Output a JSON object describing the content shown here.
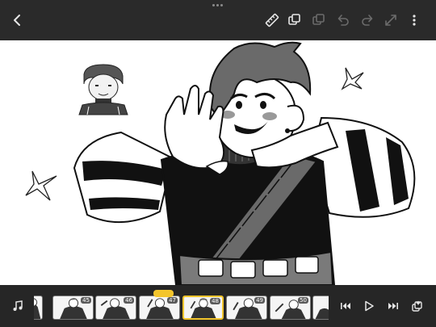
{
  "toolbar": {
    "icons": [
      "back-chevron-icon",
      "ruler-icon",
      "layers-icon",
      "copy-icon",
      "undo-icon",
      "redo-icon",
      "expand-icon",
      "more-icon"
    ]
  },
  "timeline": {
    "frames": [
      {
        "label": ""
      },
      {
        "label": "45"
      },
      {
        "label": "46"
      },
      {
        "label": "47"
      },
      {
        "label": "48"
      },
      {
        "label": "49"
      },
      {
        "label": "50"
      },
      {
        "label": ""
      }
    ],
    "current_frame": "48",
    "accent_color": "#f3c52c"
  },
  "playback": {
    "icons": [
      "music-icon",
      "skip-back-icon",
      "play-icon",
      "skip-forward-icon",
      "onion-skin-icon"
    ]
  },
  "colors": {
    "bar_background": "#2a2a2a",
    "canvas_background": "#ffffff",
    "icon_active": "#e6e6e6",
    "icon_disabled": "#6b6b6b"
  }
}
